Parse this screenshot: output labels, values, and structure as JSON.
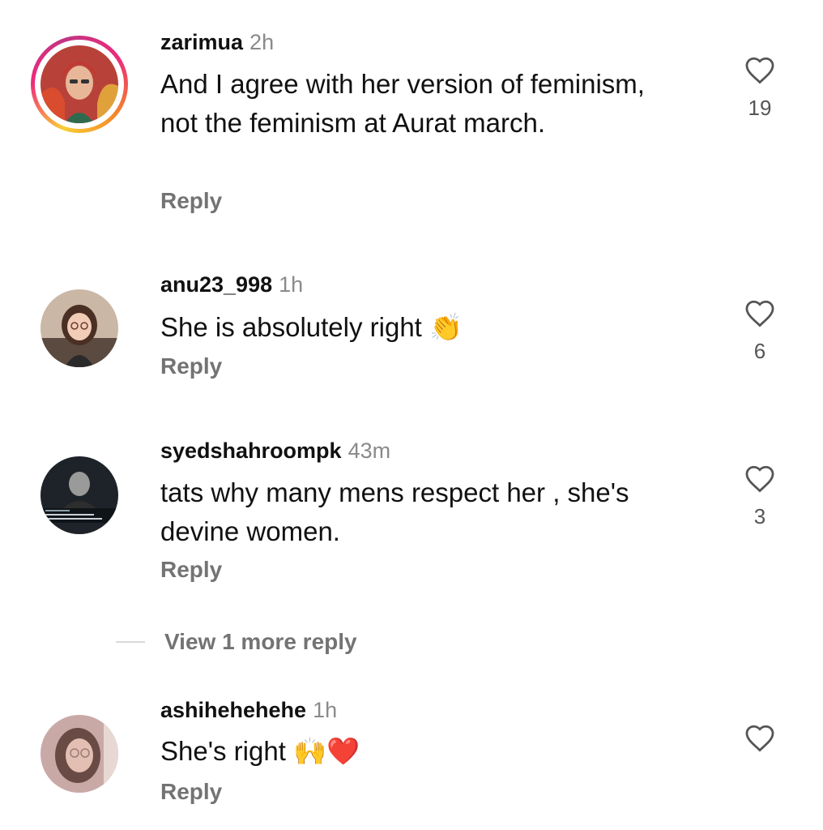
{
  "comments": [
    {
      "username": "zarimua",
      "time": "2h",
      "text": "And I agree with her version of feminism, not the feminism at Aurat march.",
      "reply_label": "Reply",
      "likes": "19",
      "avatar_icon": "profile-photo"
    },
    {
      "username": "anu23_998",
      "time": "1h",
      "text": "She is absolutely right 👏",
      "reply_label": "Reply",
      "likes": "6",
      "avatar_icon": "profile-photo"
    },
    {
      "username": "syedshahroompk",
      "time": "43m",
      "text": "tats why many mens respect her , she's devine women.",
      "reply_label": "Reply",
      "likes": "3",
      "avatar_icon": "profile-photo"
    },
    {
      "username": "ashihehehehe",
      "time": "1h",
      "text": "She's right 🙌❤️",
      "reply_label": "Reply",
      "likes": "",
      "avatar_icon": "profile-photo"
    }
  ],
  "view_more_replies": "View 1 more reply",
  "icons": {
    "like": "heart-outline-icon"
  },
  "colors": {
    "text": "#111111",
    "secondary": "#737373",
    "timestamp": "#8a8a8a",
    "story_ring": [
      "#f9ce34",
      "#ee2a7b",
      "#c13584",
      "#f58529"
    ]
  }
}
